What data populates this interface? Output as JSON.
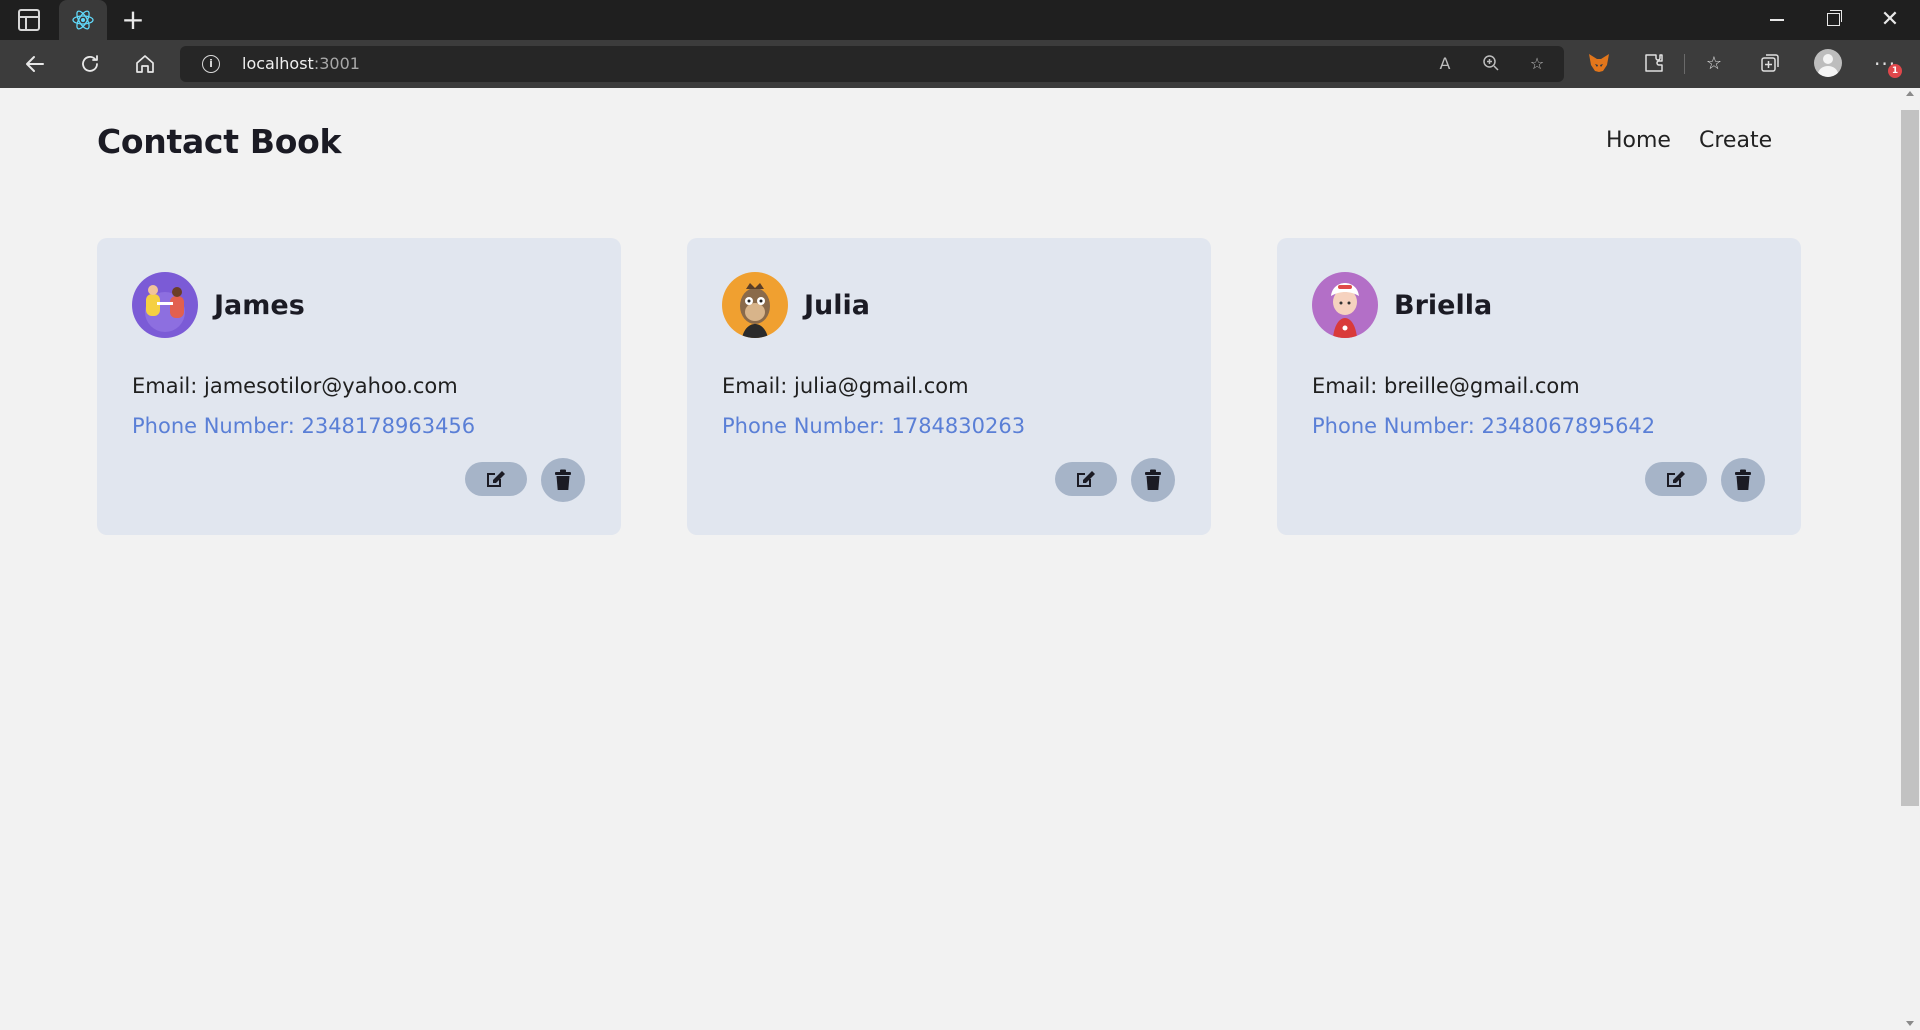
{
  "browser": {
    "url_host": "localhost",
    "url_port": ":3001",
    "tab_new_symbol": "+",
    "more_symbol": "···",
    "notification_count": "1",
    "icons": [
      "sidebar-icon",
      "react-icon",
      "back-icon",
      "refresh-icon",
      "home-icon",
      "info-icon",
      "read-aloud-icon",
      "zoom-icon",
      "favorite-add-icon",
      "metamask-fox-icon",
      "extensions-icon",
      "favorites-icon",
      "collections-icon",
      "profile-icon",
      "more-icon"
    ]
  },
  "header": {
    "brand": "Contact Book",
    "nav": [
      {
        "label": "Home"
      },
      {
        "label": "Create"
      }
    ]
  },
  "contacts": [
    {
      "name": "James",
      "email_text": "Email: jamesotilor@yahoo.com",
      "phone_text": "Phone Number: 2348178963456",
      "avatar_color": "#7b5bd6"
    },
    {
      "name": "Julia",
      "email_text": "Email: julia@gmail.com",
      "phone_text": "Phone Number: 1784830263",
      "avatar_color": "#f0a030"
    },
    {
      "name": "Briella",
      "email_text": "Email: breille@gmail.com",
      "phone_text": "Phone Number: 2348067895642",
      "avatar_color": "#b36fc7"
    }
  ],
  "colors": {
    "page_bg": "#f2f2f2",
    "card_bg": "#e1e6ef",
    "phone_text": "#5a7fd6",
    "action_button_bg": "#a6b4c8",
    "heading_text": "#1b1b24"
  }
}
